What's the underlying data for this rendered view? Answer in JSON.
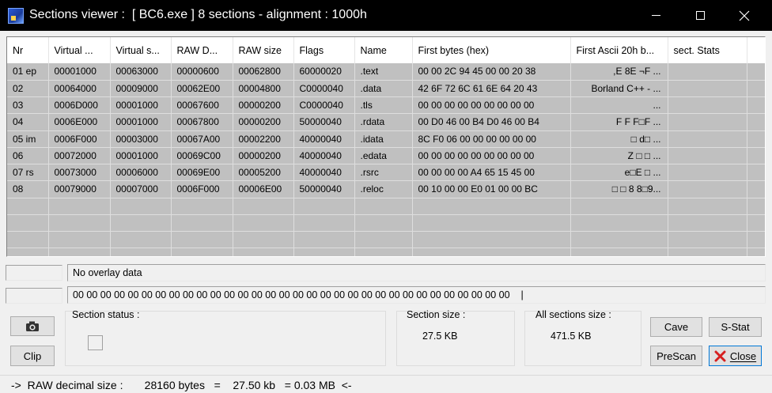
{
  "window": {
    "title": "Sections viewer :  [ BC6.exe ] 8 sections - alignment : 1000h"
  },
  "table": {
    "columns": [
      "Nr",
      "Virtual ...",
      "Virtual s...",
      "RAW D...",
      "RAW size",
      "Flags",
      "Name",
      "First bytes (hex)",
      "First Ascii 20h b...",
      "sect. Stats"
    ],
    "rows": [
      [
        "01 ep",
        "00001000",
        "00063000",
        "00000600",
        "00062800",
        "60000020",
        ".text",
        "00 00 2C 94 45 00 00 20 38",
        ",E  8E  ¬F    ...",
        ""
      ],
      [
        "02",
        "00064000",
        "00009000",
        "00062E00",
        "00004800",
        "C0000040",
        ".data",
        "42 6F 72 6C 61 6E 64 20 43",
        "Borland C++ - ...",
        ""
      ],
      [
        "03",
        "0006D000",
        "00001000",
        "00067600",
        "00000200",
        "C0000040",
        ".tls",
        "00 00 00 00 00 00 00 00 00",
        "...",
        ""
      ],
      [
        "04",
        "0006E000",
        "00001000",
        "00067800",
        "00000200",
        "50000040",
        ".rdata",
        "00 D0 46 00 B4 D0 46 00 B4",
        "F   F  F□F   ...",
        ""
      ],
      [
        "05 im",
        "0006F000",
        "00003000",
        "00067A00",
        "00002200",
        "40000040",
        ".idata",
        "8C F0 06 00 00 00 00 00 00",
        "□          d□    ...",
        ""
      ],
      [
        "06",
        "00072000",
        "00001000",
        "00069C00",
        "00000200",
        "40000040",
        ".edata",
        "00 00 00 00 00 00 00 00 00",
        "Z □ □ ...",
        ""
      ],
      [
        "07 rs",
        "00073000",
        "00006000",
        "00069E00",
        "00005200",
        "40000040",
        ".rsrc",
        "00 00 00 00 A4 65 15 45 00",
        "e□E      □ ...",
        ""
      ],
      [
        "08",
        "00079000",
        "00007000",
        "0006F000",
        "00006E00",
        "50000040",
        ".reloc",
        "00 10 00 00 E0 01 00 00 BC",
        "□    □     8 8□9...",
        ""
      ]
    ],
    "empty_rows": 5
  },
  "overlay": {
    "text": "No overlay data"
  },
  "hex_line": {
    "text": "00 00 00 00 00 00 00 00 00 00 00 00 00 00 00 00 00 00 00 00 00 00 00 00 00 00 00 00 00 00 00 00    |"
  },
  "section_status": {
    "label": "Section status :"
  },
  "section_size": {
    "label": "Section size :",
    "value": "27.5 KB"
  },
  "all_sections": {
    "label": "All sections size :",
    "value": "471.5 KB"
  },
  "buttons": {
    "clip": "Clip",
    "cave": "Cave",
    "sstat": "S-Stat",
    "prescan": "PreScan",
    "close": "Close"
  },
  "icons": {
    "camera": "camera-icon",
    "close": "red-x-icon",
    "app": "app-icon"
  },
  "status": {
    "text": "->  RAW decimal size :       28160 bytes   =    27.50 kb   = 0.03 MB  <-"
  },
  "colors": {
    "titlebar": "#000000",
    "table_bg": "#c0c0c0",
    "close_x": "#d62020"
  }
}
